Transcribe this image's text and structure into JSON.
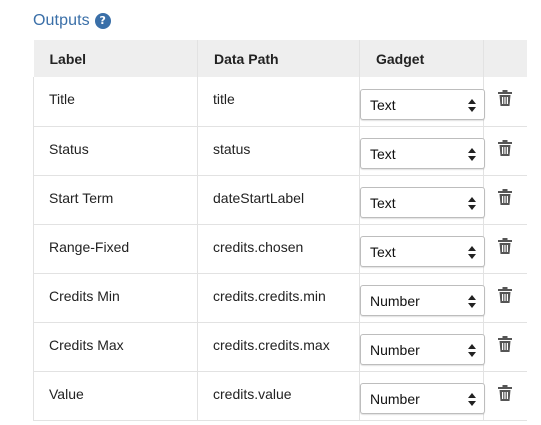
{
  "section": {
    "title": "Outputs",
    "help_icon": "question-circle-icon",
    "accent_color": "#3a6fa8"
  },
  "table": {
    "headers": {
      "label": "Label",
      "data_path": "Data Path",
      "gadget": "Gadget"
    },
    "rows": [
      {
        "label": "Title",
        "data_path": "title",
        "gadget": "Text"
      },
      {
        "label": "Status",
        "data_path": "status",
        "gadget": "Text"
      },
      {
        "label": "Start Term",
        "data_path": "dateStartLabel",
        "gadget": "Text"
      },
      {
        "label": "Range-Fixed",
        "data_path": "credits.chosen",
        "gadget": "Text"
      },
      {
        "label": "Credits Min",
        "data_path": "credits.credits.min",
        "gadget": "Number"
      },
      {
        "label": "Credits Max",
        "data_path": "credits.credits.max",
        "gadget": "Number"
      },
      {
        "label": "Value",
        "data_path": "credits.value",
        "gadget": "Number"
      }
    ],
    "delete_icon": "trash-icon"
  }
}
